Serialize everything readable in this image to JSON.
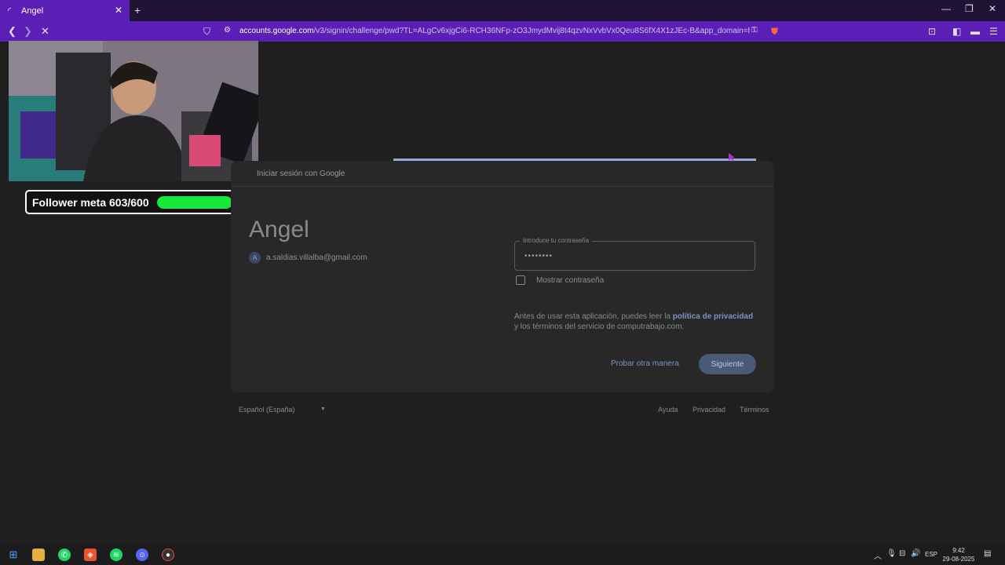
{
  "browser": {
    "tab_title": "Angel",
    "url_host": "accounts.google.com",
    "url_path": "/v3/signin/challenge/pwd?TL=ALgCv6xjgCi6-RCH36NFp-zO3JmydMvij8t4qzvNxVvbVx0Qeu8S6fX4X1zJEc-B&app_domain=https%3A..."
  },
  "overlay": {
    "follower_label": "Follower meta 603/600",
    "follower_progress": 1.0,
    "follower_color": "#19e83a"
  },
  "signin": {
    "header": "Iniciar sesión con Google",
    "name": "Angel",
    "avatar_letter": "A",
    "email": "a.saldias.villalba@gmail.com",
    "password_label": "Introduce tu contraseña",
    "password_value": "••••••••",
    "show_password": "Mostrar contraseña",
    "policy_prefix": "Antes de usar esta aplicación, puedes leer la ",
    "policy_link": "política de privacidad",
    "policy_suffix": " y los términos del servicio de computrabajo.com.",
    "other_way": "Probar otra manera",
    "next": "Siguiente"
  },
  "footer": {
    "language": "Español (España)",
    "help": "Ayuda",
    "privacy": "Privacidad",
    "terms": "Términos"
  },
  "taskbar": {
    "lang": "ESP",
    "time": "9:42",
    "date": "29-08-2025"
  }
}
